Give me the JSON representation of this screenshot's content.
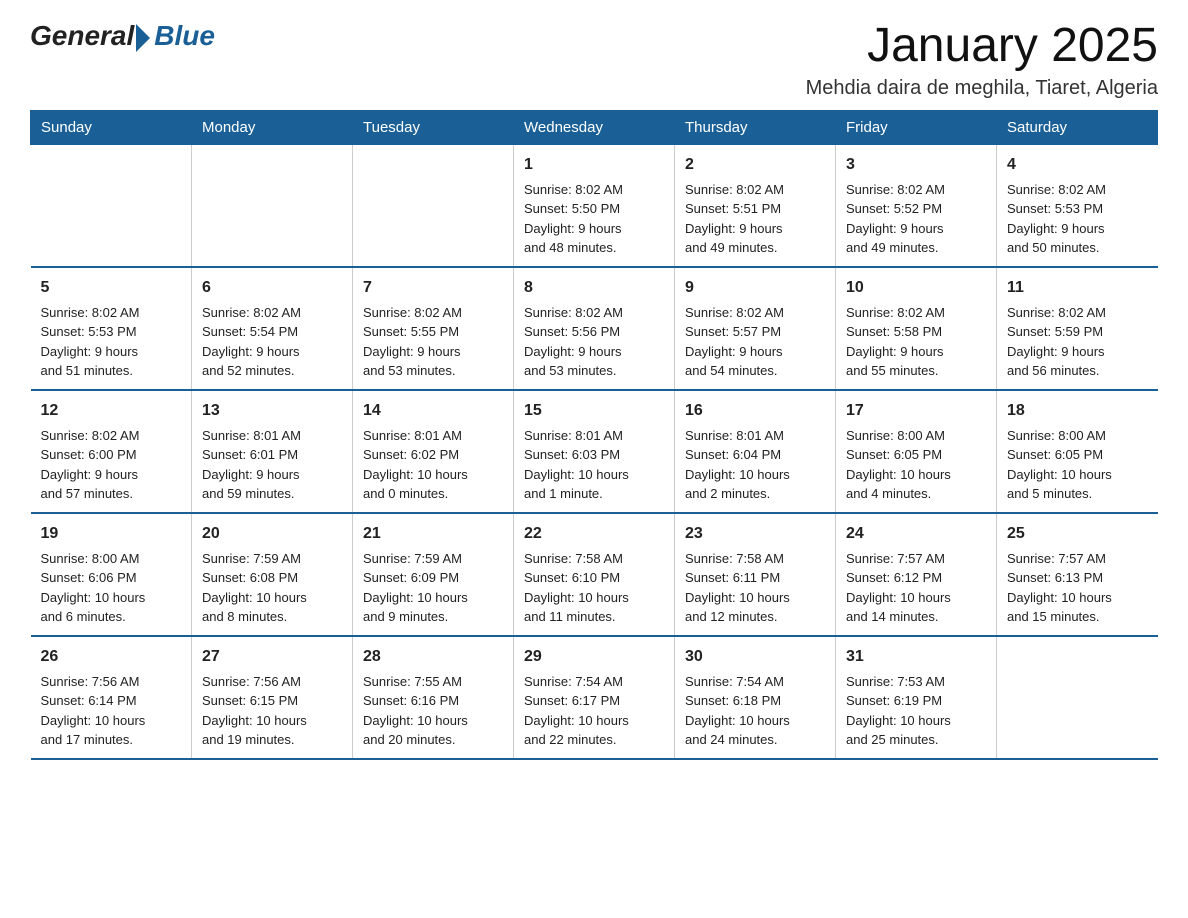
{
  "logo": {
    "general": "General",
    "blue": "Blue"
  },
  "header": {
    "title": "January 2025",
    "subtitle": "Mehdia daira de meghila, Tiaret, Algeria"
  },
  "days_of_week": [
    "Sunday",
    "Monday",
    "Tuesday",
    "Wednesday",
    "Thursday",
    "Friday",
    "Saturday"
  ],
  "weeks": [
    [
      {
        "day": "",
        "info": ""
      },
      {
        "day": "",
        "info": ""
      },
      {
        "day": "",
        "info": ""
      },
      {
        "day": "1",
        "info": "Sunrise: 8:02 AM\nSunset: 5:50 PM\nDaylight: 9 hours\nand 48 minutes."
      },
      {
        "day": "2",
        "info": "Sunrise: 8:02 AM\nSunset: 5:51 PM\nDaylight: 9 hours\nand 49 minutes."
      },
      {
        "day": "3",
        "info": "Sunrise: 8:02 AM\nSunset: 5:52 PM\nDaylight: 9 hours\nand 49 minutes."
      },
      {
        "day": "4",
        "info": "Sunrise: 8:02 AM\nSunset: 5:53 PM\nDaylight: 9 hours\nand 50 minutes."
      }
    ],
    [
      {
        "day": "5",
        "info": "Sunrise: 8:02 AM\nSunset: 5:53 PM\nDaylight: 9 hours\nand 51 minutes."
      },
      {
        "day": "6",
        "info": "Sunrise: 8:02 AM\nSunset: 5:54 PM\nDaylight: 9 hours\nand 52 minutes."
      },
      {
        "day": "7",
        "info": "Sunrise: 8:02 AM\nSunset: 5:55 PM\nDaylight: 9 hours\nand 53 minutes."
      },
      {
        "day": "8",
        "info": "Sunrise: 8:02 AM\nSunset: 5:56 PM\nDaylight: 9 hours\nand 53 minutes."
      },
      {
        "day": "9",
        "info": "Sunrise: 8:02 AM\nSunset: 5:57 PM\nDaylight: 9 hours\nand 54 minutes."
      },
      {
        "day": "10",
        "info": "Sunrise: 8:02 AM\nSunset: 5:58 PM\nDaylight: 9 hours\nand 55 minutes."
      },
      {
        "day": "11",
        "info": "Sunrise: 8:02 AM\nSunset: 5:59 PM\nDaylight: 9 hours\nand 56 minutes."
      }
    ],
    [
      {
        "day": "12",
        "info": "Sunrise: 8:02 AM\nSunset: 6:00 PM\nDaylight: 9 hours\nand 57 minutes."
      },
      {
        "day": "13",
        "info": "Sunrise: 8:01 AM\nSunset: 6:01 PM\nDaylight: 9 hours\nand 59 minutes."
      },
      {
        "day": "14",
        "info": "Sunrise: 8:01 AM\nSunset: 6:02 PM\nDaylight: 10 hours\nand 0 minutes."
      },
      {
        "day": "15",
        "info": "Sunrise: 8:01 AM\nSunset: 6:03 PM\nDaylight: 10 hours\nand 1 minute."
      },
      {
        "day": "16",
        "info": "Sunrise: 8:01 AM\nSunset: 6:04 PM\nDaylight: 10 hours\nand 2 minutes."
      },
      {
        "day": "17",
        "info": "Sunrise: 8:00 AM\nSunset: 6:05 PM\nDaylight: 10 hours\nand 4 minutes."
      },
      {
        "day": "18",
        "info": "Sunrise: 8:00 AM\nSunset: 6:05 PM\nDaylight: 10 hours\nand 5 minutes."
      }
    ],
    [
      {
        "day": "19",
        "info": "Sunrise: 8:00 AM\nSunset: 6:06 PM\nDaylight: 10 hours\nand 6 minutes."
      },
      {
        "day": "20",
        "info": "Sunrise: 7:59 AM\nSunset: 6:08 PM\nDaylight: 10 hours\nand 8 minutes."
      },
      {
        "day": "21",
        "info": "Sunrise: 7:59 AM\nSunset: 6:09 PM\nDaylight: 10 hours\nand 9 minutes."
      },
      {
        "day": "22",
        "info": "Sunrise: 7:58 AM\nSunset: 6:10 PM\nDaylight: 10 hours\nand 11 minutes."
      },
      {
        "day": "23",
        "info": "Sunrise: 7:58 AM\nSunset: 6:11 PM\nDaylight: 10 hours\nand 12 minutes."
      },
      {
        "day": "24",
        "info": "Sunrise: 7:57 AM\nSunset: 6:12 PM\nDaylight: 10 hours\nand 14 minutes."
      },
      {
        "day": "25",
        "info": "Sunrise: 7:57 AM\nSunset: 6:13 PM\nDaylight: 10 hours\nand 15 minutes."
      }
    ],
    [
      {
        "day": "26",
        "info": "Sunrise: 7:56 AM\nSunset: 6:14 PM\nDaylight: 10 hours\nand 17 minutes."
      },
      {
        "day": "27",
        "info": "Sunrise: 7:56 AM\nSunset: 6:15 PM\nDaylight: 10 hours\nand 19 minutes."
      },
      {
        "day": "28",
        "info": "Sunrise: 7:55 AM\nSunset: 6:16 PM\nDaylight: 10 hours\nand 20 minutes."
      },
      {
        "day": "29",
        "info": "Sunrise: 7:54 AM\nSunset: 6:17 PM\nDaylight: 10 hours\nand 22 minutes."
      },
      {
        "day": "30",
        "info": "Sunrise: 7:54 AM\nSunset: 6:18 PM\nDaylight: 10 hours\nand 24 minutes."
      },
      {
        "day": "31",
        "info": "Sunrise: 7:53 AM\nSunset: 6:19 PM\nDaylight: 10 hours\nand 25 minutes."
      },
      {
        "day": "",
        "info": ""
      }
    ]
  ]
}
